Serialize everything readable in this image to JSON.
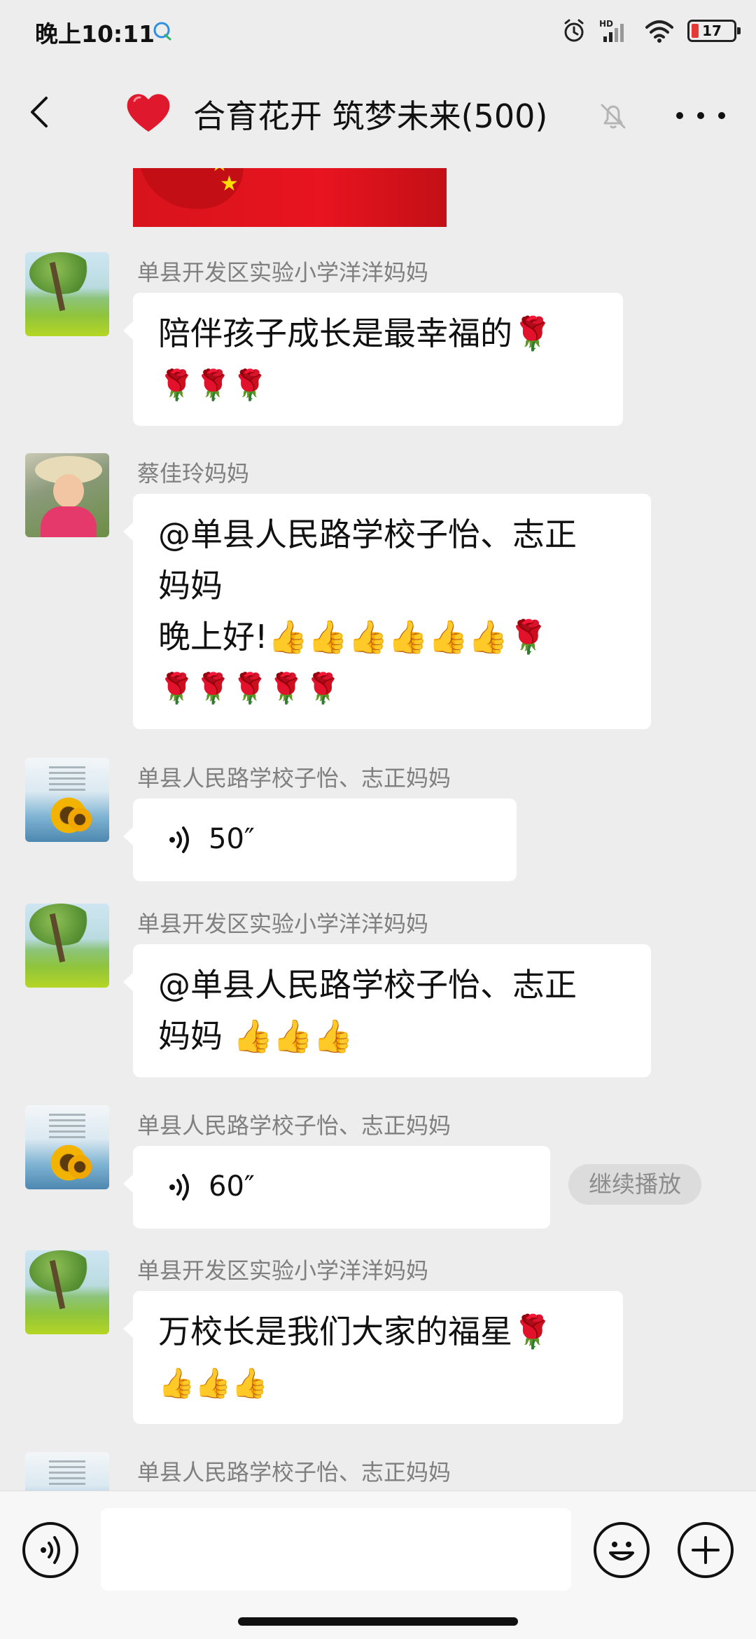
{
  "status_bar": {
    "time": "晚上10:11",
    "battery": "17",
    "battery_color": "#e53935"
  },
  "title_bar": {
    "title": "合育花开 筑梦未来(500)",
    "title_emoji": "heart-icon",
    "mute_icon": "bell-off-icon"
  },
  "messages": [
    {
      "sender": "单县开发区实验小学洋洋妈妈",
      "avatar": "tree-landscape-avatar",
      "lines": [
        "陪伴孩子成长是最幸福的🌹",
        "🌹🌹🌹"
      ]
    },
    {
      "sender": "蔡佳玲妈妈",
      "avatar": "girl-with-hat-avatar",
      "lines": [
        "@单县人民路学校子怡、志正",
        "妈妈",
        "晚上好!👍👍👍👍👍👍🌹",
        "🌹🌹🌹🌹🌹"
      ]
    },
    {
      "sender": "单县人民路学校子怡、志正妈妈",
      "avatar": "sunflower-avatar",
      "voice_duration": "50″"
    },
    {
      "sender": "单县开发区实验小学洋洋妈妈",
      "avatar": "tree-landscape-avatar",
      "lines": [
        "@单县人民路学校子怡、志正",
        "妈妈 👍👍👍"
      ]
    },
    {
      "sender": "单县人民路学校子怡、志正妈妈",
      "avatar": "sunflower-avatar",
      "voice_duration": "60″",
      "continue_label": "继续播放"
    },
    {
      "sender": "单县开发区实验小学洋洋妈妈",
      "avatar": "tree-landscape-avatar",
      "lines": [
        "万校长是我们大家的福星🌹",
        "👍👍👍"
      ]
    },
    {
      "sender": "单县人民路学校子怡、志正妈妈",
      "avatar": "sunflower-avatar"
    }
  ],
  "input_bar": {
    "text_value": "",
    "voice_icon": "voice-input-icon",
    "emoji_icon": "emoji-icon",
    "plus_icon": "plus-icon"
  }
}
